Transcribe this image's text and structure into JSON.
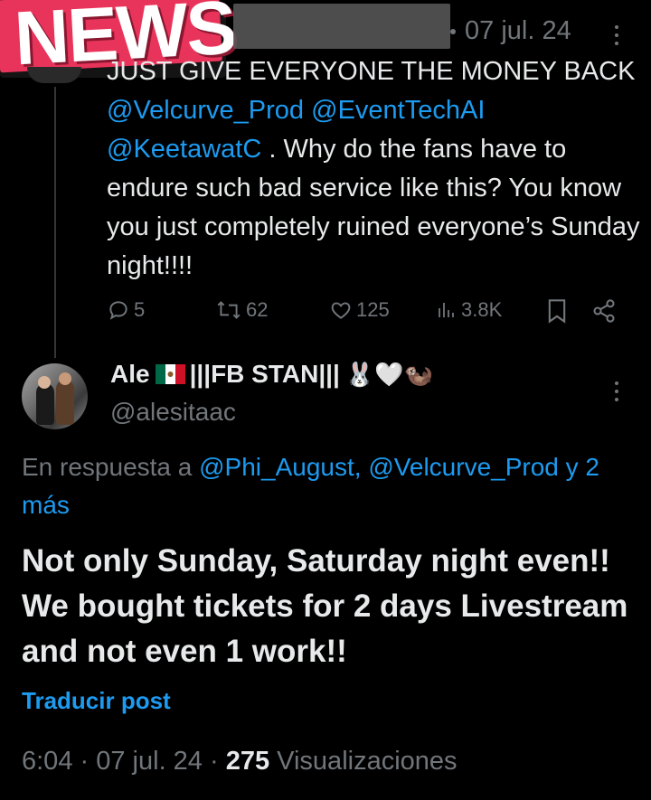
{
  "sticker": {
    "text": "NEWS"
  },
  "parent_tweet": {
    "date": "07 jul. 24",
    "text_pre": "JUST GIVE EVERYONE THE MONEY BACK",
    "mentions": [
      "@Velcurve_Prod",
      "@EventTechAI",
      "@KeetawatC"
    ],
    "text_post": " . Why do the fans have to endure such bad service like this? You know you just completely ruined everyone’s Sunday night!!!!",
    "actions": {
      "replies": "5",
      "reposts": "62",
      "likes": "125",
      "views": "3.8K"
    }
  },
  "tweet": {
    "author": {
      "name": "Ale",
      "name_tail": "|||FB STAN|||",
      "emoji": "🐰🤍🦦",
      "handle": "@alesitaac"
    },
    "reply_label": "En respuesta a",
    "reply_mentions": "@Phi_August, @Velcurve_Prod y 2",
    "reply_more": "más",
    "text": "Not only Sunday, Saturday night even!! We bought tickets for 2 days Livestream and not even 1 work!!",
    "translate": "Traducir post",
    "time": "6:04",
    "date": "07 jul. 24",
    "views_count": "275",
    "views_label": "Visualizaciones"
  },
  "colors": {
    "accent": "#1d9bf0",
    "muted": "#71767b",
    "text": "#e7e9ea",
    "background": "#000000",
    "sticker": "#e8345a"
  },
  "icons": [
    "reply-icon",
    "repost-icon",
    "like-icon",
    "views-icon",
    "bookmark-icon",
    "share-icon",
    "more-icon",
    "mexico-flag-icon"
  ]
}
